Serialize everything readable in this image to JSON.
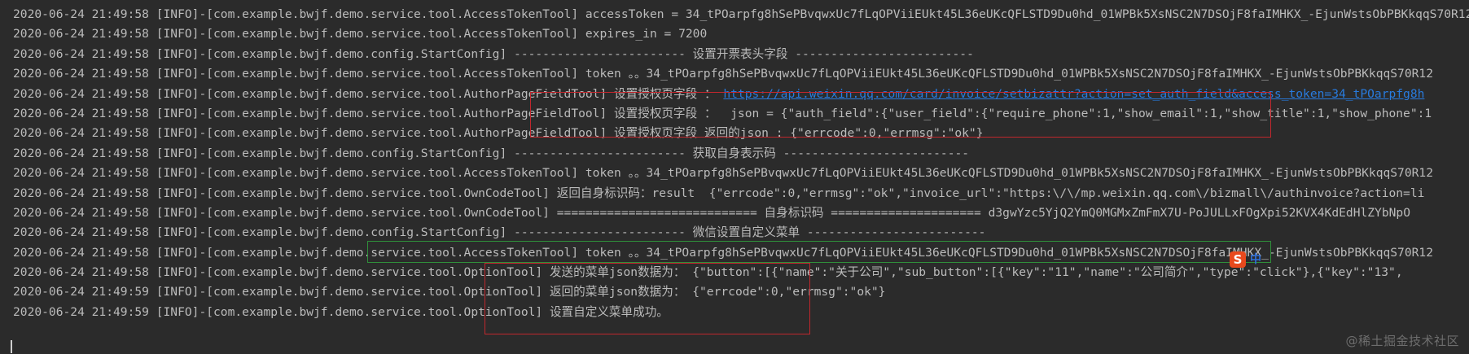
{
  "console": {
    "lines": [
      {
        "segments": [
          {
            "text": "2020-06-24 21:49:58 [INFO]-[com.example.bwjf.demo.service.tool.AccessTokenTool] accessToken = 34_tPOarpfg8hSePBvqwxUc7fLqOPViiEUkt45L36eUKcQFLSTD9Du0hd_01WPBk5XsNSC2N7DSOjF8faIMHKX_-EjunWstsObPBKkqqS70R12"
          }
        ]
      },
      {
        "segments": [
          {
            "text": "2020-06-24 21:49:58 [INFO]-[com.example.bwjf.demo.service.tool.AccessTokenTool] expires_in = 7200"
          }
        ]
      },
      {
        "segments": [
          {
            "text": "2020-06-24 21:49:58 [INFO]-[com.example.bwjf.demo.config.StartConfig] ------------------------ 设置开票表头字段 -------------------------"
          }
        ]
      },
      {
        "segments": [
          {
            "text": "2020-06-24 21:49:58 [INFO]-[com.example.bwjf.demo.service.tool.AccessTokenTool] token 。。34_tPOarpfg8hSePBvqwxUc7fLqOPViiEUkt45L36eUKcQFLSTD9Du0hd_01WPBk5XsNSC2N7DSOjF8faIMHKX_-EjunWstsObPBKkqqS70R12"
          }
        ]
      },
      {
        "segments": [
          {
            "text": "2020-06-24 21:49:58 [INFO]-[com.example.bwjf.demo.service.tool.AuthorPageFieldTool] 设置授权页字段 ： "
          },
          {
            "text": "https://api.weixin.qq.com/card/invoice/setbizattr?action=set_auth_field&access_token=34_tPOarpfg8h",
            "link": true
          }
        ]
      },
      {
        "segments": [
          {
            "text": "2020-06-24 21:49:58 [INFO]-[com.example.bwjf.demo.service.tool.AuthorPageFieldTool] 设置授权页字段 ：  json = {\"auth_field\":{\"user_field\":{\"require_phone\":1,\"show_email\":1,\"show_title\":1,\"show_phone\":1"
          }
        ]
      },
      {
        "segments": [
          {
            "text": "2020-06-24 21:49:58 [INFO]-[com.example.bwjf.demo.service.tool.AuthorPageFieldTool] 设置授权页字段 返回的json : {\"errcode\":0,\"errmsg\":\"ok\"}"
          }
        ]
      },
      {
        "segments": [
          {
            "text": "2020-06-24 21:49:58 [INFO]-[com.example.bwjf.demo.config.StartConfig] ------------------------ 获取自身表示码 --------------------------"
          }
        ]
      },
      {
        "segments": [
          {
            "text": "2020-06-24 21:49:58 [INFO]-[com.example.bwjf.demo.service.tool.AccessTokenTool] token 。。34_tPOarpfg8hSePBvqwxUc7fLqOPViiEUkt45L36eUKcQFLSTD9Du0hd_01WPBk5XsNSC2N7DSOjF8faIMHKX_-EjunWstsObPBKkqqS70R12"
          }
        ]
      },
      {
        "segments": [
          {
            "text": "2020-06-24 21:49:58 [INFO]-[com.example.bwjf.demo.service.tool.OwnCodeTool] 返回自身标识码：result  {\"errcode\":0,\"errmsg\":\"ok\",\"invoice_url\":\"https:\\/\\/mp.weixin.qq.com\\/bizmall\\/authinvoice?action=li"
          }
        ]
      },
      {
        "segments": [
          {
            "text": "2020-06-24 21:49:58 [INFO]-[com.example.bwjf.demo.service.tool.OwnCodeTool] ============================ 自身标识码 ===================== d3gwYzc5YjQ2YmQ0MGMxZmFmX7U-PoJULLxFOgXpi52KVX4KdEdHlZYbNpO"
          }
        ]
      },
      {
        "segments": [
          {
            "text": "2020-06-24 21:49:58 [INFO]-[com.example.bwjf.demo.config.StartConfig] ------------------------ 微信设置自定义菜单 -------------------------"
          }
        ]
      },
      {
        "segments": [
          {
            "text": "2020-06-24 21:49:58 [INFO]-[com.example.bwjf.demo.service.tool.AccessTokenTool] token 。。34_tPOarpfg8hSePBvqwxUc7fLqOPViiEUkt45L36eUKcQFLSTD9Du0hd_01WPBk5XsNSC2N7DSOjF8faIMHKX_-EjunWstsObPBKkqqS70R12"
          }
        ]
      },
      {
        "segments": [
          {
            "text": "2020-06-24 21:49:58 [INFO]-[com.example.bwjf.demo.service.tool.OptionTool] 发送的菜单json数据为： {\"button\":[{\"name\":\"关于公司\",\"sub_button\":[{\"key\":\"11\",\"name\":\"公司简介\",\"type\":\"click\"},{\"key\":\"13\","
          }
        ]
      },
      {
        "segments": [
          {
            "text": "2020-06-24 21:49:59 [INFO]-[com.example.bwjf.demo.service.tool.OptionTool] 返回的菜单json数据为： {\"errcode\":0,\"errmsg\":\"ok\"}"
          }
        ]
      },
      {
        "segments": [
          {
            "text": "2020-06-24 21:49:59 [INFO]-[com.example.bwjf.demo.service.tool.OptionTool] 设置自定义菜单成功。"
          }
        ]
      }
    ]
  },
  "ime": {
    "badge_letter": "S",
    "mode_label": "中"
  },
  "watermark": {
    "text": "@稀土掘金技术社区"
  },
  "colors": {
    "background": "#2b2b2b",
    "text": "#bbbbbb",
    "link": "#287bde",
    "highlight_red": "#c1272d",
    "highlight_green": "#2f8f3a"
  }
}
